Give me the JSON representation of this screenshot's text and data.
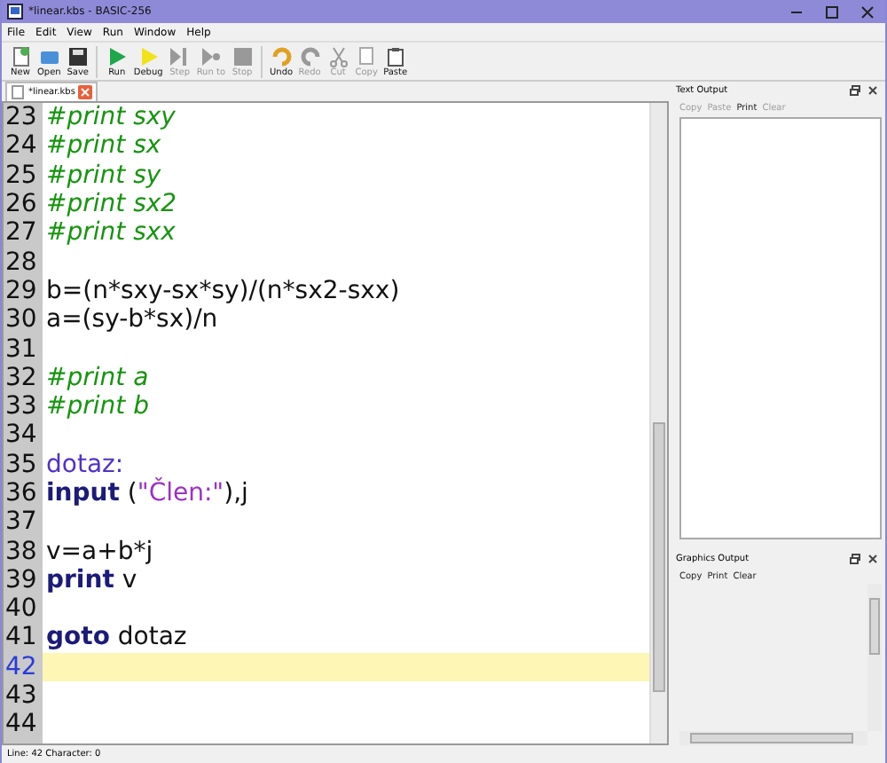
{
  "window": {
    "title": "*linear.kbs - BASIC-256"
  },
  "menu": [
    "File",
    "Edit",
    "View",
    "Run",
    "Window",
    "Help"
  ],
  "toolbar": [
    {
      "label": "New",
      "disabled": false
    },
    {
      "label": "Open",
      "disabled": false
    },
    {
      "label": "Save",
      "disabled": false
    },
    {
      "label": "Run",
      "disabled": false
    },
    {
      "label": "Debug",
      "disabled": false
    },
    {
      "label": "Step",
      "disabled": true
    },
    {
      "label": "Run to",
      "disabled": true
    },
    {
      "label": "Stop",
      "disabled": true
    },
    {
      "label": "Undo",
      "disabled": false
    },
    {
      "label": "Redo",
      "disabled": true
    },
    {
      "label": "Cut",
      "disabled": true
    },
    {
      "label": "Copy",
      "disabled": true
    },
    {
      "label": "Paste",
      "disabled": false
    }
  ],
  "tabs": [
    {
      "label": "*linear.kbs",
      "selected": true
    }
  ],
  "editor": {
    "lines": [
      {
        "number": "23",
        "current": false,
        "tokens": [
          {
            "kind": "comment",
            "text": "#print sxy"
          }
        ]
      },
      {
        "number": "24",
        "current": false,
        "tokens": [
          {
            "kind": "comment",
            "text": "#print sx"
          }
        ]
      },
      {
        "number": "25",
        "current": false,
        "tokens": [
          {
            "kind": "comment",
            "text": "#print sy"
          }
        ]
      },
      {
        "number": "26",
        "current": false,
        "tokens": [
          {
            "kind": "comment",
            "text": "#print sx2"
          }
        ]
      },
      {
        "number": "27",
        "current": false,
        "tokens": [
          {
            "kind": "comment",
            "text": "#print sxx"
          }
        ]
      },
      {
        "number": "28",
        "current": false
      },
      {
        "number": "29",
        "current": false,
        "tokens": [
          {
            "kind": "plain",
            "text": "b=(n*sxy-sx*sy)/(n*sx2-sxx)"
          }
        ]
      },
      {
        "number": "30",
        "current": false,
        "tokens": [
          {
            "kind": "plain",
            "text": "a=(sy-b*sx)/n"
          }
        ]
      },
      {
        "number": "31",
        "current": false
      },
      {
        "number": "32",
        "current": false,
        "tokens": [
          {
            "kind": "comment",
            "text": "#print a"
          }
        ]
      },
      {
        "number": "33",
        "current": false,
        "tokens": [
          {
            "kind": "comment",
            "text": "#print b"
          }
        ]
      },
      {
        "number": "34",
        "current": false
      },
      {
        "number": "35",
        "current": false,
        "tokens": [
          {
            "kind": "label",
            "text": "dotaz:"
          }
        ]
      },
      {
        "number": "36",
        "current": false,
        "tokens": [
          {
            "kind": "keyword",
            "text": "input"
          },
          {
            "kind": "plain",
            "text": " ("
          },
          {
            "kind": "string",
            "text": "\"Člen:\""
          },
          {
            "kind": "plain",
            "text": "),j"
          }
        ]
      },
      {
        "number": "37",
        "current": false
      },
      {
        "number": "38",
        "current": false,
        "tokens": [
          {
            "kind": "plain",
            "text": "v=a+b*j"
          }
        ]
      },
      {
        "number": "39",
        "current": false,
        "tokens": [
          {
            "kind": "keyword",
            "text": "print"
          },
          {
            "kind": "plain",
            "text": " v"
          }
        ]
      },
      {
        "number": "40",
        "current": false
      },
      {
        "number": "41",
        "current": false,
        "tokens": [
          {
            "kind": "keyword",
            "text": "goto"
          },
          {
            "kind": "plain",
            "text": " dotaz"
          }
        ]
      },
      {
        "number": "42",
        "current": true
      },
      {
        "number": "43",
        "current": false
      },
      {
        "number": "44",
        "current": false
      }
    ]
  },
  "text_output": {
    "title": "Text Output",
    "actions": [
      {
        "label": "Copy",
        "disabled": true
      },
      {
        "label": "Paste",
        "disabled": true
      },
      {
        "label": "Print",
        "disabled": false
      },
      {
        "label": "Clear",
        "disabled": true
      }
    ]
  },
  "graphics_output": {
    "title": "Graphics Output",
    "actions": [
      {
        "label": "Copy",
        "disabled": false
      },
      {
        "label": "Print",
        "disabled": false
      },
      {
        "label": "Clear",
        "disabled": false
      }
    ]
  },
  "status_bar": {
    "text": "Line: 42 Character: 0"
  }
}
